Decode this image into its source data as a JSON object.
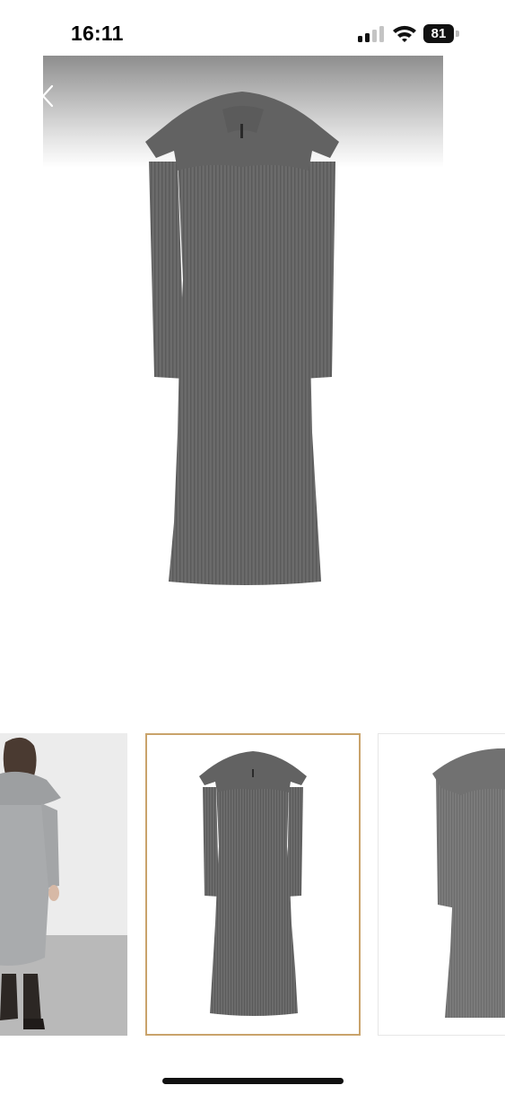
{
  "status_bar": {
    "time": "16:11",
    "battery_level": "81",
    "icons": [
      "cellular-signal-icon",
      "wifi-icon",
      "battery-icon"
    ]
  },
  "gallery": {
    "selected_index": 1,
    "selected_border_color": "#c9a36b",
    "thumbnails": [
      {
        "name": "model-back-view"
      },
      {
        "name": "dress-front-view"
      },
      {
        "name": "dress-side-view"
      }
    ]
  },
  "colors": {
    "product": "#6c6c6c",
    "background": "#ffffff"
  }
}
